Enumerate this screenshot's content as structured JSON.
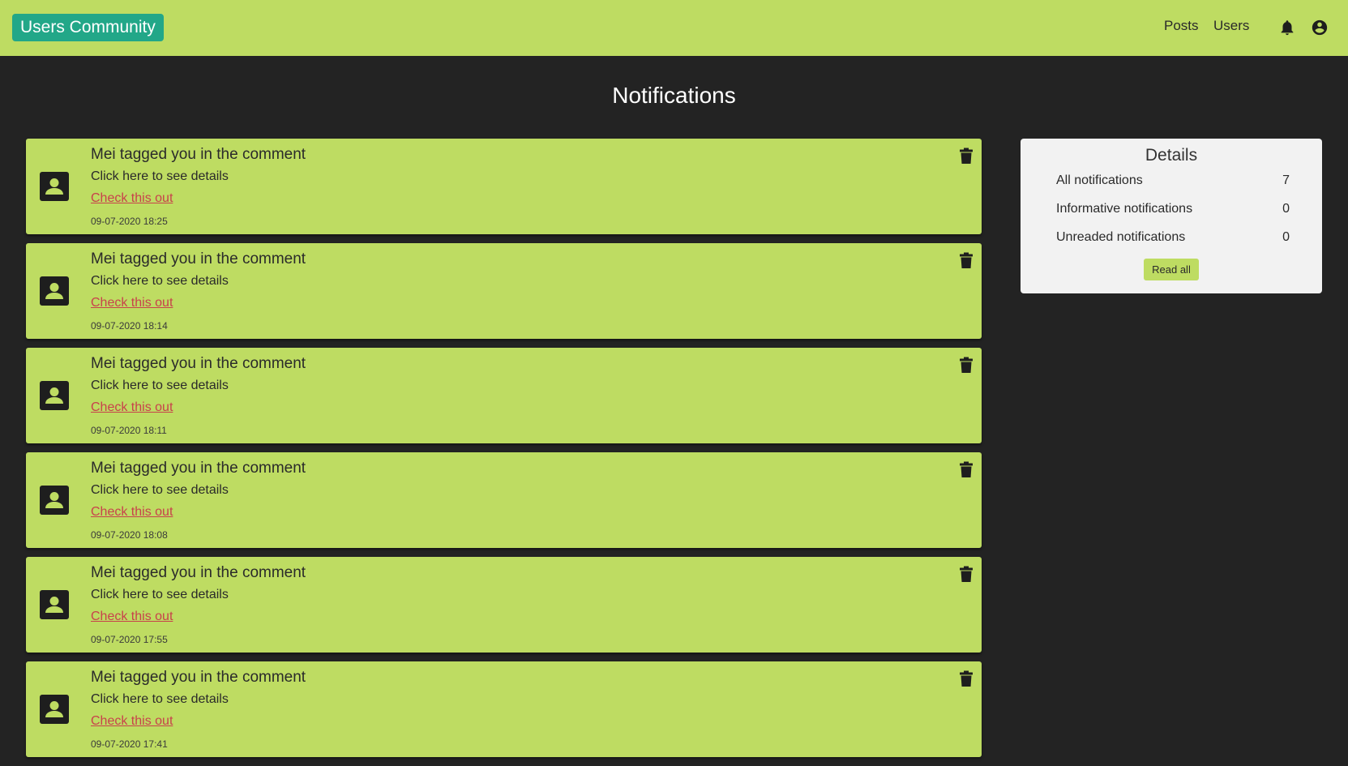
{
  "navbar": {
    "brand": "Users Community",
    "links": [
      {
        "label": "Posts"
      },
      {
        "label": "Users"
      }
    ],
    "icons": [
      "bell-icon",
      "account-circle-icon"
    ]
  },
  "page": {
    "title": "Notifications"
  },
  "notifications": [
    {
      "title": "Mei tagged you in the comment",
      "subtitle": "Click here to see details",
      "link": "Check this out",
      "time": "09-07-2020 18:25"
    },
    {
      "title": "Mei tagged you in the comment",
      "subtitle": "Click here to see details",
      "link": "Check this out",
      "time": "09-07-2020 18:14"
    },
    {
      "title": "Mei tagged you in the comment",
      "subtitle": "Click here to see details",
      "link": "Check this out",
      "time": "09-07-2020 18:11"
    },
    {
      "title": "Mei tagged you in the comment",
      "subtitle": "Click here to see details",
      "link": "Check this out",
      "time": "09-07-2020 18:08"
    },
    {
      "title": "Mei tagged you in the comment",
      "subtitle": "Click here to see details",
      "link": "Check this out",
      "time": "09-07-2020 17:55"
    },
    {
      "title": "Mei tagged you in the comment",
      "subtitle": "Click here to see details",
      "link": "Check this out",
      "time": "09-07-2020 17:41"
    }
  ],
  "details": {
    "title": "Details",
    "rows": [
      {
        "label": "All notifications",
        "value": "7"
      },
      {
        "label": "Informative notifications",
        "value": "0"
      },
      {
        "label": "Unreaded notifications",
        "value": "0"
      }
    ],
    "read_all_label": "Read all"
  },
  "colors": {
    "background": "#232323",
    "accent": "#bedc62",
    "brand": "#22a788",
    "link": "#c8424b",
    "panel": "#f2f2f2"
  }
}
